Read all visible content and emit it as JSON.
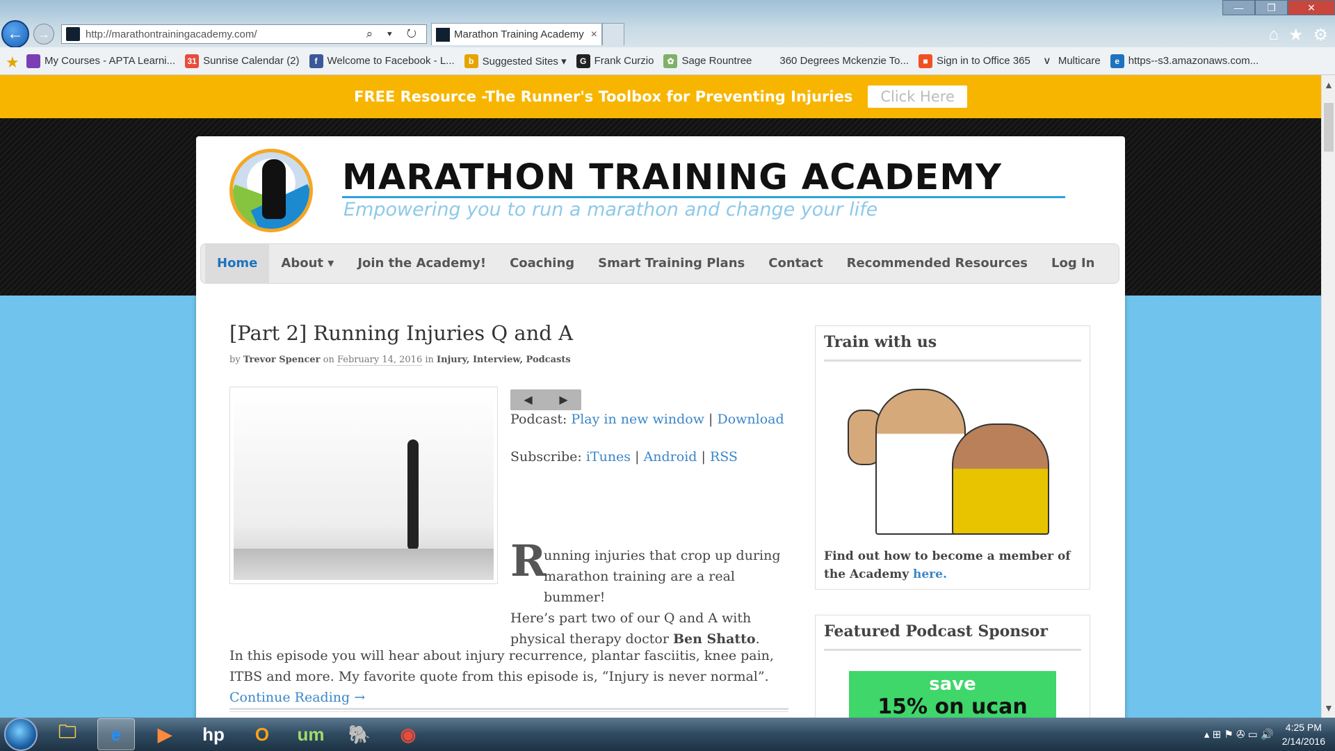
{
  "browser": {
    "url": "http://marathontrainingacademy.com/",
    "tab_title": "Marathon Training Academy",
    "tab_close": "×",
    "back_icon": "←",
    "forward_icon": "→",
    "address_controls": "⌕ ▾ ↻",
    "window_controls": [
      "—",
      "❐",
      "✕"
    ],
    "toolbar_icons": [
      "⌂",
      "★",
      "⚙"
    ]
  },
  "favorites": [
    {
      "label": "My Courses - APTA Learni...",
      "icon_color": "#7a3fb5",
      "icon_text": ""
    },
    {
      "label": "Sunrise Calendar (2)",
      "icon_color": "#e74c3c",
      "icon_text": "31"
    },
    {
      "label": "Welcome to Facebook - L...",
      "icon_color": "#3b5998",
      "icon_text": "f"
    },
    {
      "label": "Suggested Sites ▾",
      "icon_color": "#e6a400",
      "icon_text": "b"
    },
    {
      "label": "Frank Curzio",
      "icon_color": "#222222",
      "icon_text": "G"
    },
    {
      "label": "Sage Rountree",
      "icon_color": "#7fb069",
      "icon_text": "✿"
    },
    {
      "label": "360 Degrees Mckenzie  To...",
      "icon_color": "#eef2f5",
      "icon_text": ""
    },
    {
      "label": "Sign in to Office 365",
      "icon_color": "#f25022",
      "icon_text": "■"
    },
    {
      "label": "Multicare",
      "icon_color": "#eef2f5",
      "icon_text": "V"
    },
    {
      "label": "https--s3.amazonaws.com...",
      "icon_color": "#1e73be",
      "icon_text": "e"
    }
  ],
  "banner": {
    "text": "FREE Resource -The Runner's Toolbox for Preventing Injuries",
    "button": "Click Here"
  },
  "site": {
    "title": "MARATHON TRAINING ACADEMY",
    "tagline": "Empowering you to run a marathon and change your life"
  },
  "nav": [
    {
      "label": "Home",
      "active": true
    },
    {
      "label": "About ▾",
      "active": false
    },
    {
      "label": "Join the Academy!",
      "active": false
    },
    {
      "label": "Coaching",
      "active": false
    },
    {
      "label": "Smart Training Plans",
      "active": false
    },
    {
      "label": "Contact",
      "active": false
    },
    {
      "label": "Recommended Resources",
      "active": false
    },
    {
      "label": "Log In",
      "active": false
    }
  ],
  "post": {
    "title": "[Part 2] Running Injuries Q and A",
    "by": "by",
    "author": "Trevor Spencer",
    "on": "on",
    "date": "February 14, 2016",
    "in": "in",
    "categories": "Injury, Interview, Podcasts",
    "podcast_label": "Podcast:",
    "play_link": "Play in new window",
    "sep": "|",
    "download_link": "Download",
    "subscribe_label": "Subscribe:",
    "itunes": "iTunes",
    "android": "Android",
    "rss": "RSS",
    "dropcap": "R",
    "intro": "unning injuries that crop up during marathon training are a real bummer!",
    "para2_pre": "Here’s part two of our Q and A with physical therapy doctor ",
    "para2_bold": "Ben Shatto",
    "para2_post": ".",
    "para3": "In this episode you will hear about injury recurrence, plantar fasciitis, knee pain, ITBS and more. My favorite quote from this episode is, “Injury is never normal”. ",
    "continue": "Continue Reading →"
  },
  "player": {
    "prev": "◀",
    "next": "▶"
  },
  "sidebar": {
    "w1_title": "Train with us",
    "w1_text": "Find out how to become a member of the Academy ",
    "w1_link": "here.",
    "w2_title": "Featured Podcast Sponsor",
    "sponsor_l1": "save",
    "sponsor_l2": "15% on ucan"
  },
  "taskbar": {
    "apps": [
      "🗀",
      "e",
      "▶",
      "hp",
      "O",
      "um",
      "🐘",
      "◉"
    ],
    "tray": "▴ ⊞ ⚑ ✇ ▭ 🔊",
    "time": "4:25 PM",
    "date": "2/14/2016"
  }
}
